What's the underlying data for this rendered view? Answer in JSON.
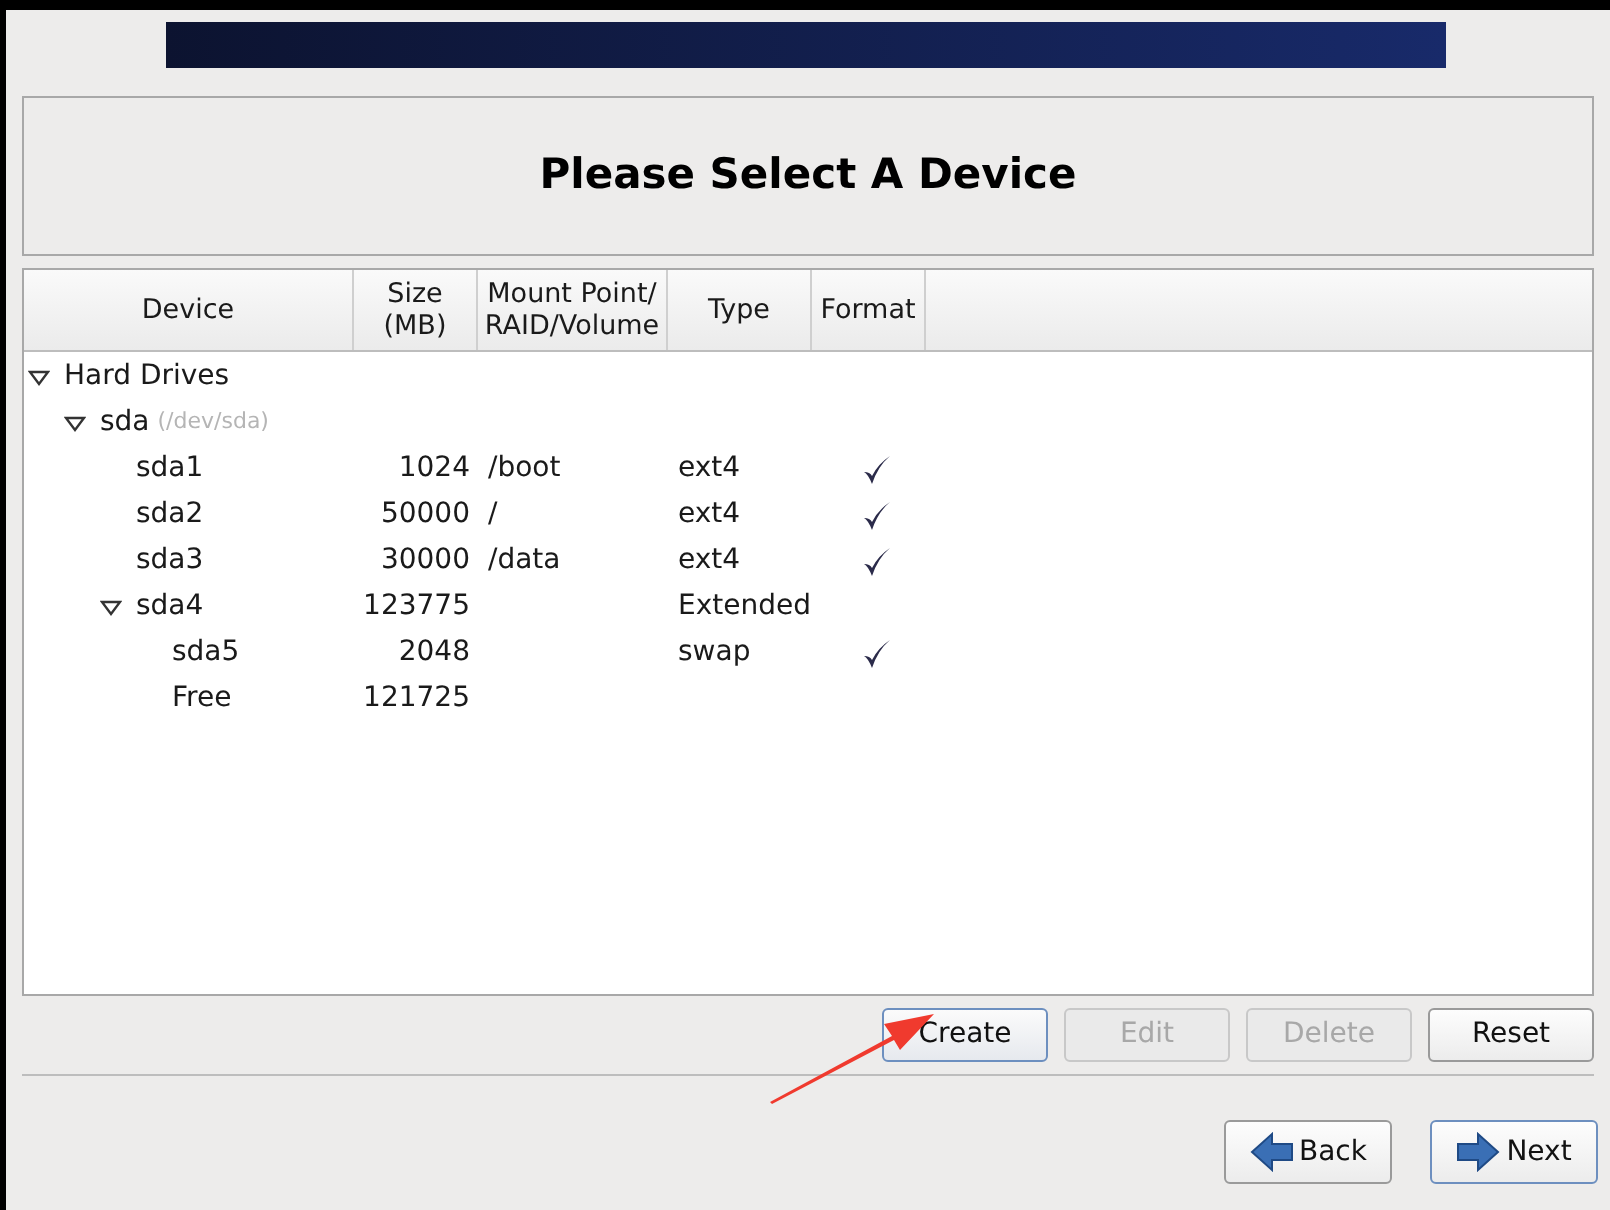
{
  "title": "Please Select A Device",
  "table": {
    "columns": [
      "Device",
      "Size\n(MB)",
      "Mount Point/\nRAID/Volume",
      "Type",
      "Format"
    ],
    "rows": [
      {
        "device": "Hard Drives",
        "expanded": true,
        "children": [
          {
            "device": "sda",
            "note": "(/dev/sda)",
            "expanded": true,
            "children": [
              {
                "device": "sda1",
                "size": "1024",
                "mount": "/boot",
                "type": "ext4",
                "format": true
              },
              {
                "device": "sda2",
                "size": "50000",
                "mount": "/",
                "type": "ext4",
                "format": true
              },
              {
                "device": "sda3",
                "size": "30000",
                "mount": "/data",
                "type": "ext4",
                "format": true
              },
              {
                "device": "sda4",
                "size": "123775",
                "type": "Extended",
                "format": false,
                "expanded": true,
                "children": [
                  {
                    "device": "sda5",
                    "size": "2048",
                    "type": "swap",
                    "format": true
                  },
                  {
                    "device": "Free",
                    "size": "121725",
                    "format": false
                  }
                ]
              }
            ]
          }
        ]
      }
    ]
  },
  "actions": [
    {
      "label": "Create",
      "disabled": false
    },
    {
      "label": "Edit",
      "disabled": true
    },
    {
      "label": "Delete",
      "disabled": true
    },
    {
      "label": "Reset",
      "disabled": false
    }
  ],
  "navigation": [
    {
      "label": "Back",
      "kind": "back"
    },
    {
      "label": "Next",
      "kind": "next"
    }
  ]
}
